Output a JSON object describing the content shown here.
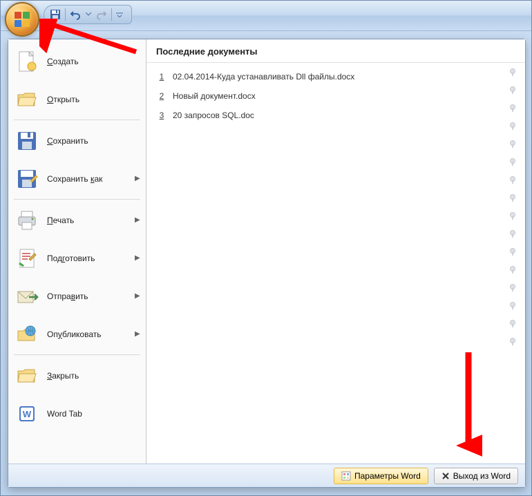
{
  "qat": {
    "save_tip": "Сохранить",
    "undo_tip": "Отменить",
    "redo_tip": "Повторить"
  },
  "menu": {
    "items": [
      {
        "label": "Создать",
        "icon": "new-doc-icon",
        "has_submenu": false
      },
      {
        "label": "Открыть",
        "icon": "open-folder-icon",
        "has_submenu": false
      },
      {
        "label": "Сохранить",
        "icon": "save-disk-icon",
        "has_submenu": false
      },
      {
        "label": "Сохранить как",
        "icon": "save-as-icon",
        "has_submenu": true
      },
      {
        "label": "Печать",
        "icon": "print-icon",
        "has_submenu": true
      },
      {
        "label": "Подготовить",
        "icon": "prepare-icon",
        "has_submenu": true
      },
      {
        "label": "Отправить",
        "icon": "send-icon",
        "has_submenu": true
      },
      {
        "label": "Опубликовать",
        "icon": "publish-icon",
        "has_submenu": true
      },
      {
        "label": "Закрыть",
        "icon": "close-folder-icon",
        "has_submenu": false
      },
      {
        "label": "Word Tab",
        "icon": "word-tab-icon",
        "has_submenu": false
      }
    ]
  },
  "recent": {
    "header": "Последние документы",
    "docs": [
      {
        "num": "1",
        "name": "02.04.2014-Куда устанавливать Dll файлы.docx"
      },
      {
        "num": "2",
        "name": "Новый документ.docx"
      },
      {
        "num": "3",
        "name": "20 запросов SQL.doc"
      }
    ],
    "pin_count": 16
  },
  "footer": {
    "options_label": "Параметры Word",
    "exit_label": "Выход из Word"
  }
}
